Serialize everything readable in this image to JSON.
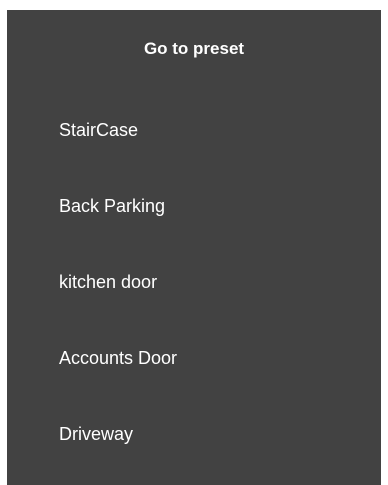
{
  "dialog": {
    "title": "Go to preset",
    "presets": [
      {
        "label": "StairCase"
      },
      {
        "label": "Back Parking"
      },
      {
        "label": "kitchen door"
      },
      {
        "label": "Accounts Door"
      },
      {
        "label": "Driveway"
      }
    ]
  },
  "colors": {
    "background": "#424242",
    "text": "#ffffff"
  }
}
